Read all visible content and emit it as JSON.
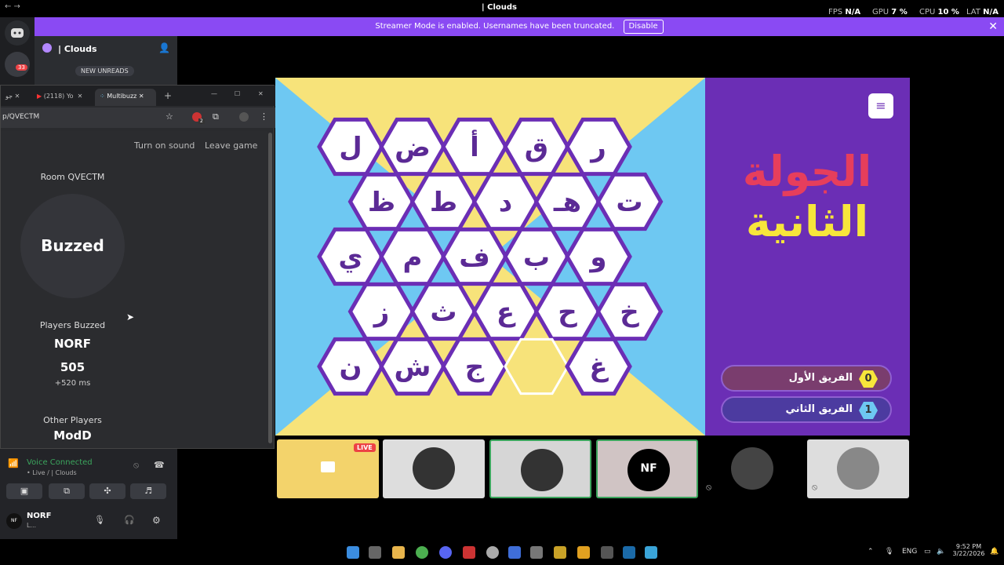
{
  "titlebar": {
    "title": "| Clouds",
    "fps_label": "FPS",
    "fps_value": "N/A",
    "gpu_label": "GPU",
    "gpu_value": "7 %",
    "cpu_label": "CPU",
    "cpu_value": "10 %",
    "lat_label": "LAT",
    "lat_value": "N/A"
  },
  "banner": {
    "text": "Streamer Mode is enabled. Usernames have been truncated.",
    "disable_label": "Disable",
    "close": "✕"
  },
  "servers": {
    "badge": "33"
  },
  "channels": {
    "server_name": "| Clouds",
    "new_unreads": "NEW UNREADS"
  },
  "browser": {
    "tabs": [
      {
        "label": "جو"
      },
      {
        "label": "(2118) Yo"
      },
      {
        "label": "Multibuzz"
      }
    ],
    "url": "p/QVECTM",
    "ext_badge": "2"
  },
  "page": {
    "sound_label": "Turn on sound",
    "leave_label": "Leave game",
    "room": "Room QVECTM",
    "buzzed": "Buzzed",
    "players_buzzed_label": "Players Buzzed",
    "buzzed_player": "NORF",
    "score": "505",
    "time": "+520 ms",
    "other_players_label": "Other Players",
    "other_player": "ModD"
  },
  "voice": {
    "status": "Voice Connected",
    "sub": "• Live / | Clouds",
    "username": "NORF",
    "user_status": "L...",
    "avatar": "NF"
  },
  "game": {
    "round_line1": "الجولة",
    "round_line2": "الثانية",
    "menu": "≡",
    "team1_name": "الفريق الأول",
    "team1_score": "0",
    "team2_name": "الفريق الثاني",
    "team2_score": "1",
    "hex_rows": [
      [
        "ل",
        "ض",
        "أ",
        "ق",
        "ر"
      ],
      [
        "ظ",
        "ط",
        "د",
        "هـ",
        "ت"
      ],
      [
        "ي",
        "م",
        "ف",
        "ب",
        "و"
      ],
      [
        "ز",
        "ث",
        "ع",
        "ح",
        "خ"
      ],
      [
        "ن",
        "ش",
        "ج",
        "",
        "غ"
      ]
    ]
  },
  "tiles": {
    "live_label": "LIVE",
    "nf_label": "NF"
  },
  "taskbar": {
    "lang": "ENG",
    "time": "9:52 PM",
    "date": "3/22/2026"
  }
}
